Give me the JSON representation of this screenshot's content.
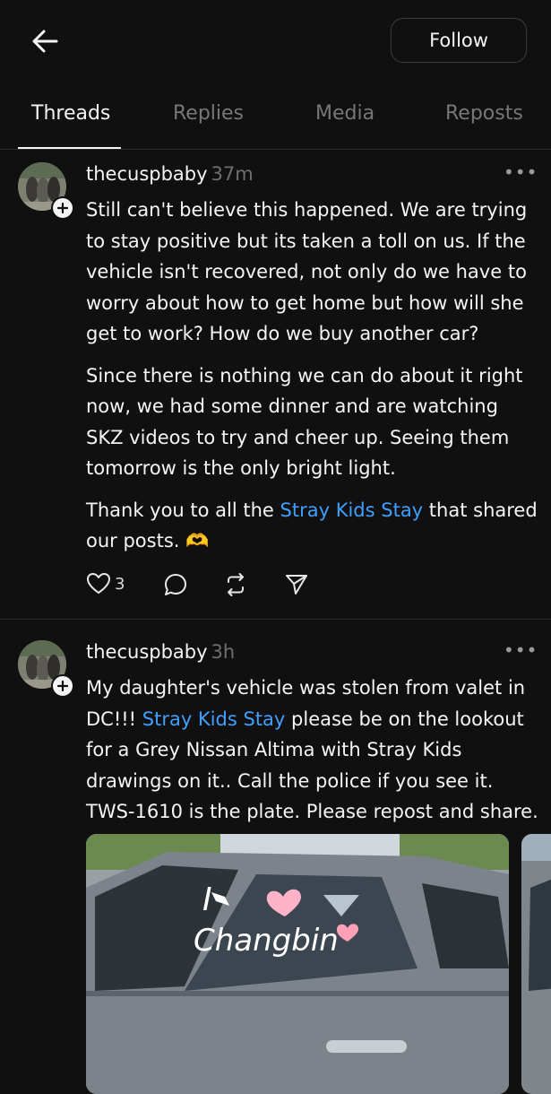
{
  "header": {
    "back_icon": "arrow-left-icon",
    "follow_label": "Follow"
  },
  "tabs": [
    {
      "label": "Threads",
      "active": true
    },
    {
      "label": "Replies",
      "active": false
    },
    {
      "label": "Media",
      "active": false
    },
    {
      "label": "Reposts",
      "active": false
    }
  ],
  "posts": [
    {
      "username": "thecuspbaby",
      "time": "37m",
      "paragraphs": [
        [
          "Still can't believe this happened.  We are trying to stay positive but its taken a toll on us.  If the vehicle isn't recovered, not only do we have to worry about how to get home but how will she get to work?  How do we buy another car?"
        ],
        [
          "Since there is nothing we can do about it right now, we had some dinner and are watching SKZ videos to try and cheer up. Seeing them tomorrow is the only bright light."
        ],
        [
          "Thank you to all the ",
          "Stray Kids Stay",
          " that shared our posts. 🫶"
        ]
      ],
      "likes": "3"
    },
    {
      "username": "thecuspbaby",
      "time": "3h",
      "paragraphs": [
        [
          "My daughter's vehicle was stolen from valet in DC!!! ",
          "Stray Kids Stay",
          "  please be on the lookout for a Grey Nissan Altima with Stray Kids drawings on it.. Call the police if you see it. TWS-1610 is the plate. Please repost and share."
        ]
      ],
      "photo_text": {
        "line1": "I",
        "line2": "Changbin"
      }
    }
  ],
  "colors": {
    "background": "#101010",
    "text": "#f3f5f7",
    "muted": "#777777",
    "link": "#3fa0ff"
  }
}
